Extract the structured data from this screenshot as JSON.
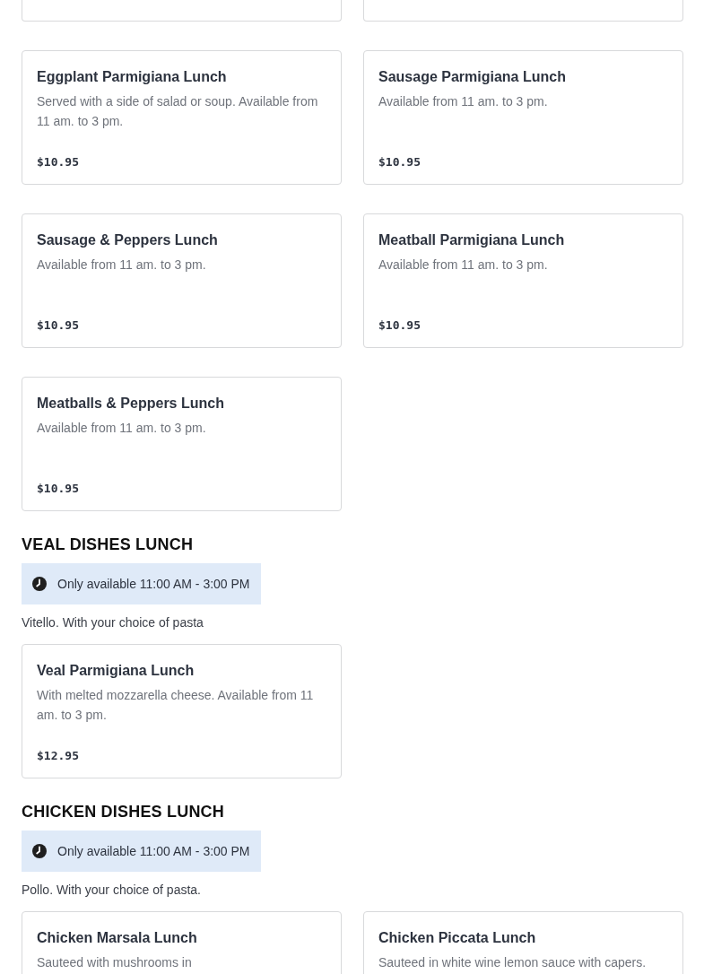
{
  "sections": [
    {
      "items": [
        {
          "kind": "cut"
        },
        {
          "kind": "cut"
        },
        {
          "kind": "full",
          "name": "Eggplant Parmigiana Lunch",
          "description": "Served with a side of salad or soup. Available from 11 am. to 3 pm.",
          "price": "$10.95"
        },
        {
          "kind": "full",
          "name": "Sausage Parmigiana Lunch",
          "description": "Available from 11 am. to 3 pm.",
          "price": "$10.95"
        },
        {
          "kind": "full",
          "name": "Sausage & Peppers Lunch",
          "description": "Available from 11 am. to 3 pm.",
          "price": "$10.95"
        },
        {
          "kind": "full",
          "name": "Meatball Parmigiana Lunch",
          "description": "Available from 11 am. to 3 pm.",
          "price": "$10.95"
        },
        {
          "kind": "full",
          "name": "Meatballs & Peppers Lunch",
          "description": "Available from 11 am. to 3 pm.",
          "price": "$10.95"
        }
      ]
    },
    {
      "title": "VEAL DISHES LUNCH",
      "availability": "Only available 11:00 AM - 3:00 PM",
      "description": "Vitello. With your choice of pasta",
      "items": [
        {
          "kind": "full",
          "name": "Veal Parmigiana Lunch",
          "description": "With melted mozzarella cheese. Available from 11 am. to 3 pm.",
          "price": "$12.95"
        }
      ]
    },
    {
      "title": "CHICKEN DISHES LUNCH",
      "availability": "Only available 11:00 AM - 3:00 PM",
      "description": "Pollo. With your choice of pasta.",
      "items": [
        {
          "kind": "full",
          "name": "Chicken Marsala Lunch",
          "description": "Sauteed with mushrooms in"
        },
        {
          "kind": "full",
          "name": "Chicken Piccata Lunch",
          "description": "Sauteed in white wine lemon sauce with capers."
        }
      ]
    }
  ]
}
